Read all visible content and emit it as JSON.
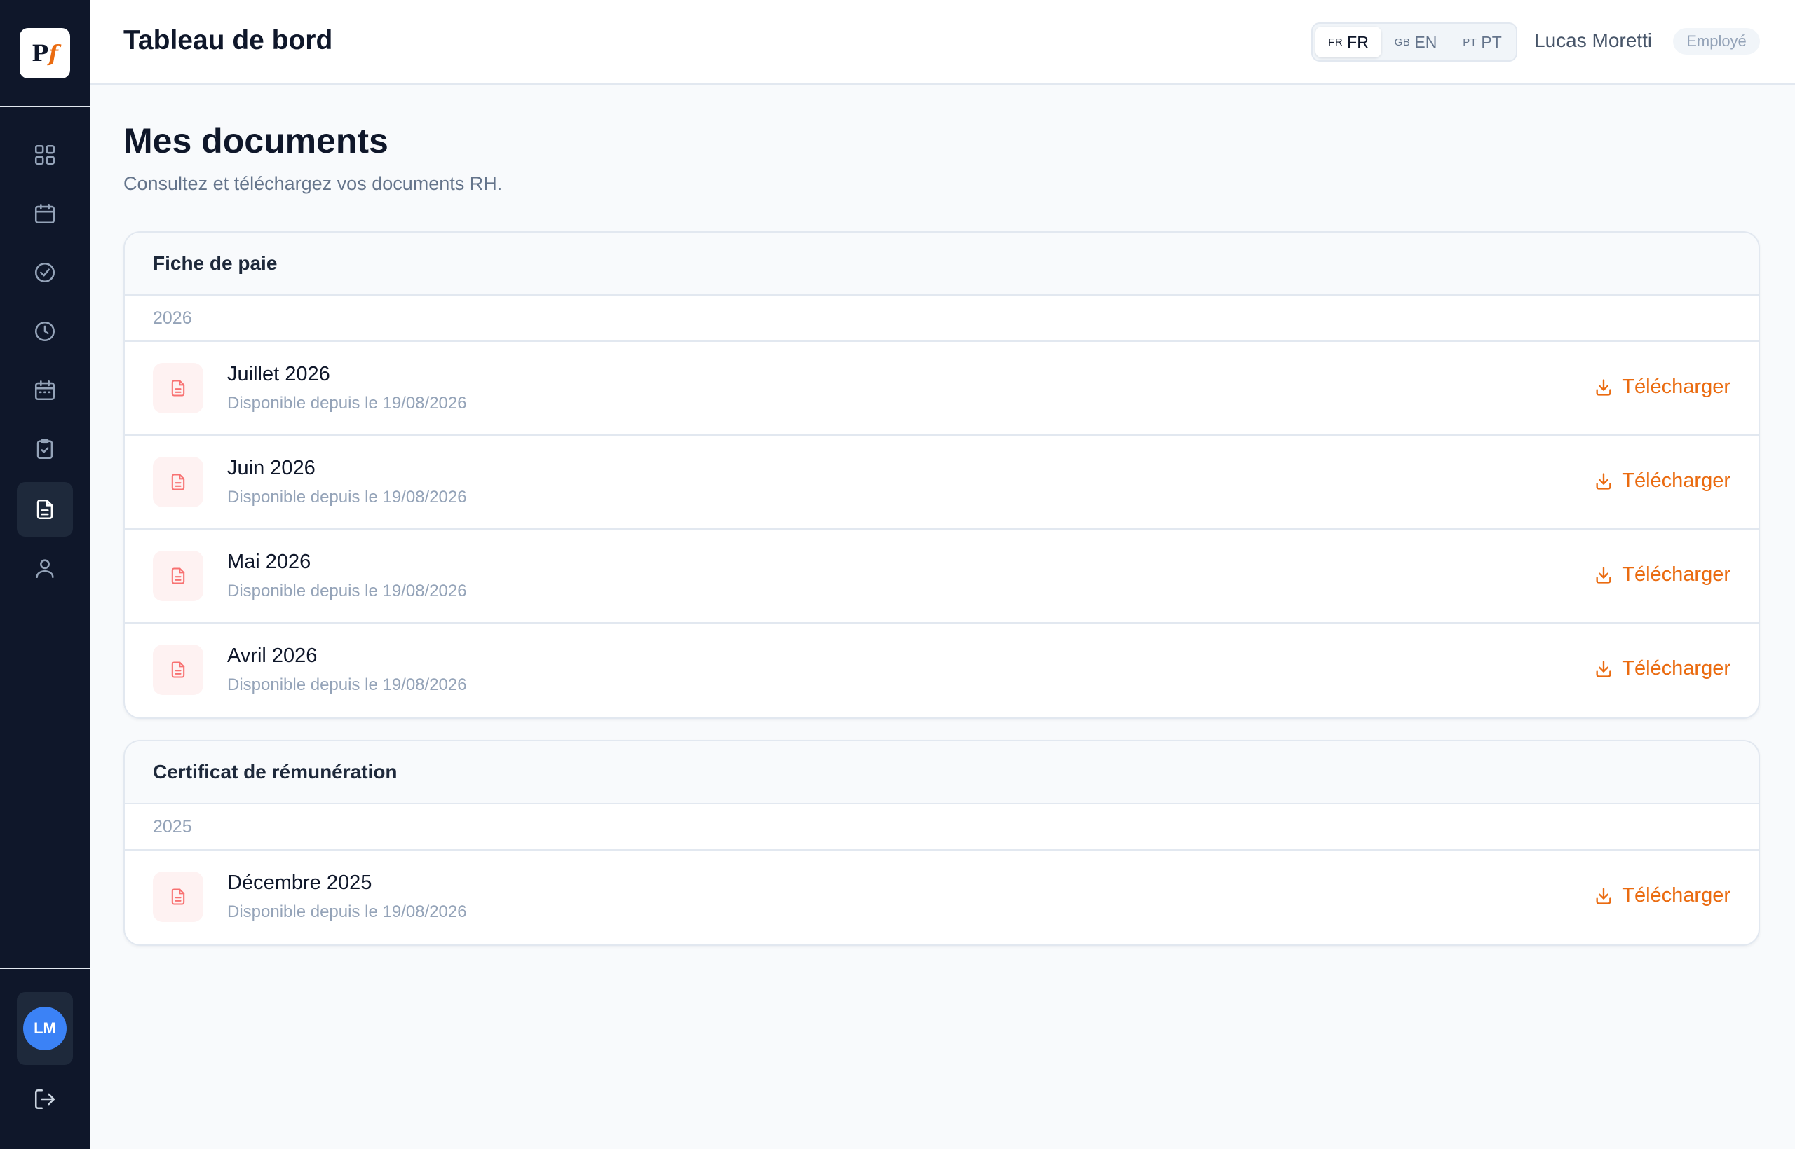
{
  "app": {
    "logo_text": "Pf"
  },
  "sidebar": {
    "items": [
      {
        "name": "dashboard",
        "icon": "grid-icon"
      },
      {
        "name": "calendar",
        "icon": "calendar-icon"
      },
      {
        "name": "approvals",
        "icon": "check-circle-icon"
      },
      {
        "name": "time",
        "icon": "clock-icon"
      },
      {
        "name": "planning",
        "icon": "calendar-grid-icon"
      },
      {
        "name": "tasks",
        "icon": "clipboard-check-icon"
      },
      {
        "name": "documents",
        "icon": "file-text-icon",
        "active": true
      },
      {
        "name": "profile",
        "icon": "user-icon"
      }
    ],
    "user_initials": "LM",
    "logout_icon": "logout-icon"
  },
  "header": {
    "title": "Tableau de bord",
    "languages": [
      {
        "flag": "FR",
        "label": "FR",
        "active": true
      },
      {
        "flag": "GB",
        "label": "EN",
        "active": false
      },
      {
        "flag": "PT",
        "label": "PT",
        "active": false
      }
    ],
    "user_name": "Lucas Moretti",
    "role": "Employé"
  },
  "page": {
    "title": "Mes documents",
    "subtitle": "Consultez et téléchargez vos documents RH."
  },
  "sections": [
    {
      "title": "Fiche de paie",
      "year": "2026",
      "documents": [
        {
          "name": "Juillet 2026",
          "available": "Disponible depuis le 19/08/2026",
          "action": "Télécharger"
        },
        {
          "name": "Juin 2026",
          "available": "Disponible depuis le 19/08/2026",
          "action": "Télécharger"
        },
        {
          "name": "Mai 2026",
          "available": "Disponible depuis le 19/08/2026",
          "action": "Télécharger"
        },
        {
          "name": "Avril 2026",
          "available": "Disponible depuis le 19/08/2026",
          "action": "Télécharger"
        }
      ]
    },
    {
      "title": "Certificat de rémunération",
      "year": "2025",
      "documents": [
        {
          "name": "Décembre 2025",
          "available": "Disponible depuis le 19/08/2026",
          "action": "Télécharger"
        }
      ]
    }
  ],
  "colors": {
    "sidebar_bg": "#0f172a",
    "accent": "#ea6b10",
    "avatar": "#3b82f6",
    "doc_icon": "#f87171"
  }
}
